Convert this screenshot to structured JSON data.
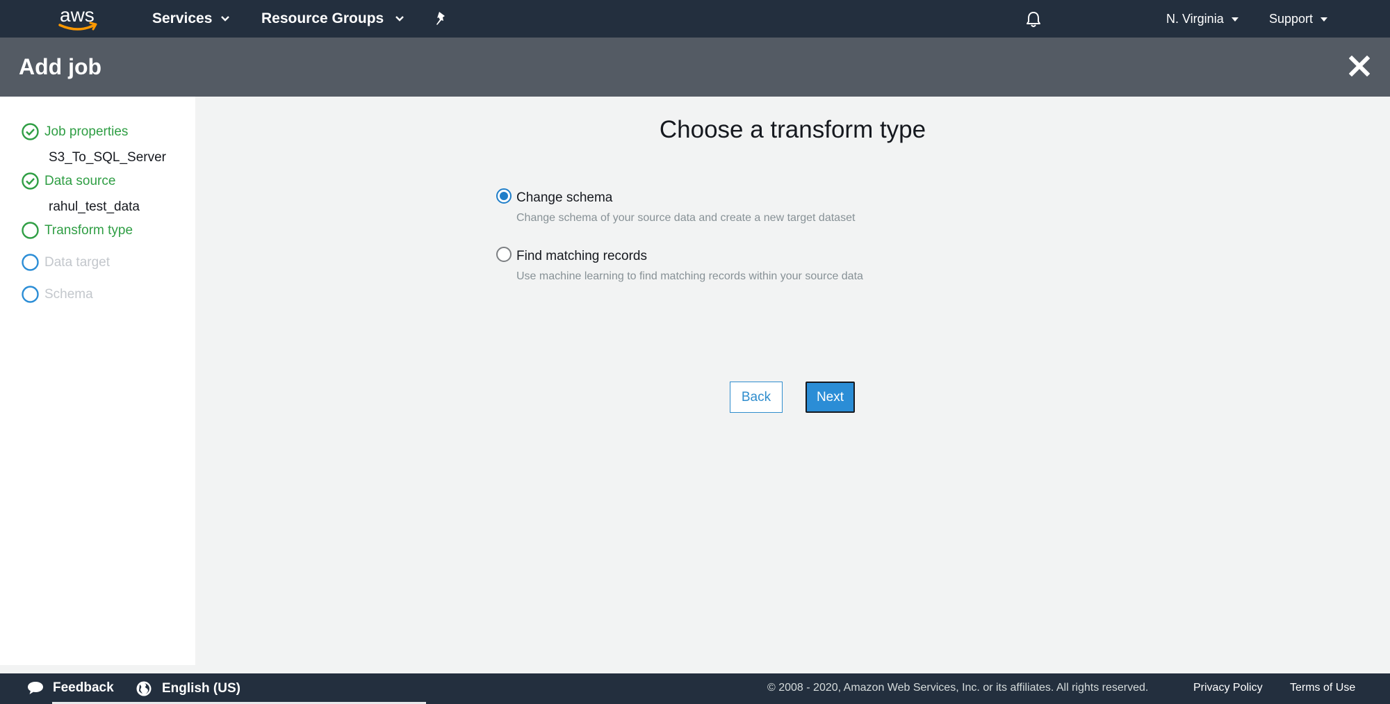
{
  "topnav": {
    "logo_text": "aws",
    "services_label": "Services",
    "resource_groups_label": "Resource Groups",
    "region_label": "N. Virginia",
    "support_label": "Support"
  },
  "titlebar": {
    "title": "Add job"
  },
  "sidebar": {
    "steps": [
      {
        "label": "Job properties",
        "sub": "S3_To_SQL_Server",
        "state": "done"
      },
      {
        "label": "Data source",
        "sub": "rahul_test_data",
        "state": "done"
      },
      {
        "label": "Transform type",
        "sub": "",
        "state": "current"
      },
      {
        "label": "Data target",
        "sub": "",
        "state": "todo"
      },
      {
        "label": "Schema",
        "sub": "",
        "state": "todo"
      }
    ]
  },
  "main": {
    "title": "Choose a transform type",
    "options": [
      {
        "label": "Change schema",
        "description": "Change schema of your source data and create a new target dataset",
        "selected": true
      },
      {
        "label": "Find matching records",
        "description": "Use machine learning to find matching records within your source data",
        "selected": false
      }
    ],
    "back_label": "Back",
    "next_label": "Next"
  },
  "footer": {
    "feedback_label": "Feedback",
    "language_label": "English (US)",
    "copyright": "© 2008 - 2020, Amazon Web Services, Inc. or its affiliates. All rights reserved.",
    "privacy_label": "Privacy Policy",
    "terms_label": "Terms of Use"
  },
  "colors": {
    "nav_bg": "#232f3e",
    "title_bg": "#545b64",
    "accent_green": "#2f9e44",
    "accent_blue": "#2b8dd6",
    "aws_orange": "#ff9900"
  }
}
